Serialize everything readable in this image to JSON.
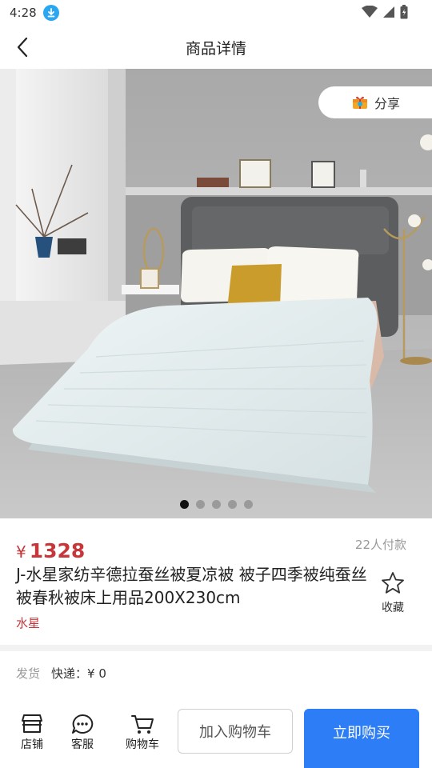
{
  "status": {
    "time": "4:28"
  },
  "nav": {
    "title": "商品详情"
  },
  "hero": {
    "share_label": "分享",
    "slides": 5,
    "active_slide": 1
  },
  "product": {
    "price_symbol": "¥",
    "price": "1328",
    "sold": "22人付款",
    "title": "J-水星家纺辛德拉蚕丝被夏凉被 被子四季被纯蚕丝被春秋被床上用品200X230cm",
    "brand": "水星",
    "favorite_label": "收藏"
  },
  "shipping": {
    "label": "发货",
    "value": "快递：¥ 0"
  },
  "bottom": {
    "store_label": "店铺",
    "service_label": "客服",
    "cart_label": "购物车",
    "add_cart_label": "加入购物车",
    "buy_label": "立即购买"
  },
  "colors": {
    "price": "#c7363a",
    "buy_button": "#2d7df6",
    "status_badge": "#2ba6f0"
  }
}
